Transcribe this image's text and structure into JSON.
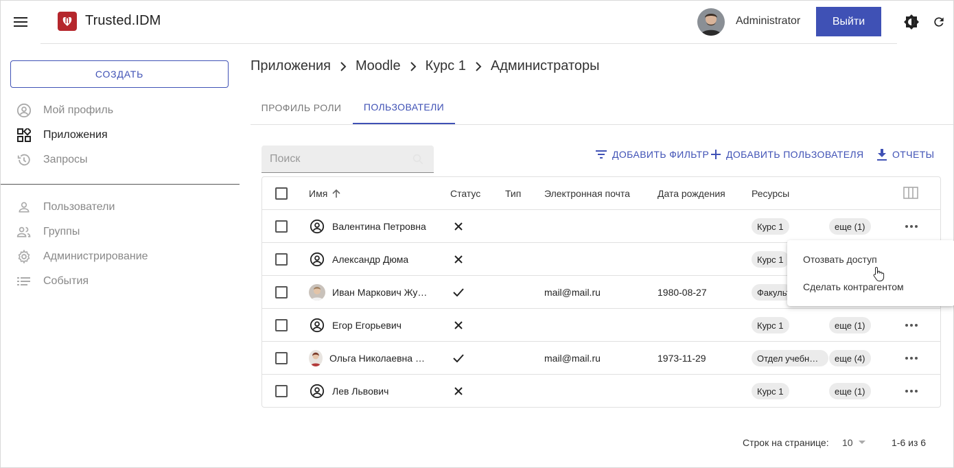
{
  "header": {
    "app_title": "Trusted.IDM",
    "username": "Administrator",
    "logout_label": "Выйти"
  },
  "sidebar": {
    "create_label": "СОЗДАТЬ",
    "items": [
      {
        "label": "Мой профиль",
        "icon": "account-circle-icon",
        "active": false
      },
      {
        "label": "Приложения",
        "icon": "apps-grid-icon",
        "active": true
      },
      {
        "label": "Запросы",
        "icon": "history-icon",
        "active": false
      },
      {
        "label": "Пользователи",
        "icon": "person-icon",
        "active": false
      },
      {
        "label": "Группы",
        "icon": "group-icon",
        "active": false
      },
      {
        "label": "Администрирование",
        "icon": "gear-icon",
        "active": false
      },
      {
        "label": "События",
        "icon": "list-icon",
        "active": false
      }
    ]
  },
  "breadcrumb": [
    "Приложения",
    "Moodle",
    "Курс 1",
    "Администраторы"
  ],
  "tabs": [
    {
      "label": "ПРОФИЛЬ РОЛИ",
      "active": false
    },
    {
      "label": "ПОЛЬЗОВАТЕЛИ",
      "active": true
    }
  ],
  "toolbar": {
    "search_placeholder": "Поиск",
    "add_filter": "ДОБАВИТЬ ФИЛЬТР",
    "add_user": "ДОБАВИТЬ ПОЛЬЗОВАТЕЛЯ",
    "reports": "ОТЧЕТЫ"
  },
  "table": {
    "columns": [
      "Имя",
      "Статус",
      "Тип",
      "Электронная почта",
      "Дата рождения",
      "Ресурсы"
    ],
    "sort_column": "Имя",
    "sort_direction": "asc",
    "rows": [
      {
        "name": "Валентина Петровна",
        "status": "inactive",
        "type": "",
        "email": "",
        "birthdate": "",
        "resource": "Курс 1",
        "more": "еще (1)",
        "has_photo": false
      },
      {
        "name": "Александр Дюма",
        "status": "inactive",
        "type": "",
        "email": "",
        "birthdate": "",
        "resource": "Курс 1",
        "more": "",
        "has_photo": false
      },
      {
        "name": "Иван Маркович Жу…",
        "status": "active",
        "type": "",
        "email": "mail@mail.ru",
        "birthdate": "1980-08-27",
        "resource": "Факульт",
        "more": "",
        "has_photo": true
      },
      {
        "name": "Егор Егорьевич",
        "status": "inactive",
        "type": "",
        "email": "",
        "birthdate": "",
        "resource": "Курс 1",
        "more": "еще (1)",
        "has_photo": false
      },
      {
        "name": "Ольга Николаевна …",
        "status": "active",
        "type": "",
        "email": "mail@mail.ru",
        "birthdate": "1973-11-29",
        "resource": "Отдел учебн…",
        "more": "еще (4)",
        "has_photo": true
      },
      {
        "name": "Лев Львович",
        "status": "inactive",
        "type": "",
        "email": "",
        "birthdate": "",
        "resource": "Курс 1",
        "more": "еще (1)",
        "has_photo": false
      }
    ]
  },
  "context_menu": {
    "items": [
      "Отозвать доступ",
      "Сделать контрагентом"
    ]
  },
  "pagination": {
    "rows_per_page_label": "Строк на странице:",
    "rows_per_page": "10",
    "range": "1-6 из 6"
  },
  "colors": {
    "primary": "#3f51b5",
    "brand": "#b5262c"
  }
}
